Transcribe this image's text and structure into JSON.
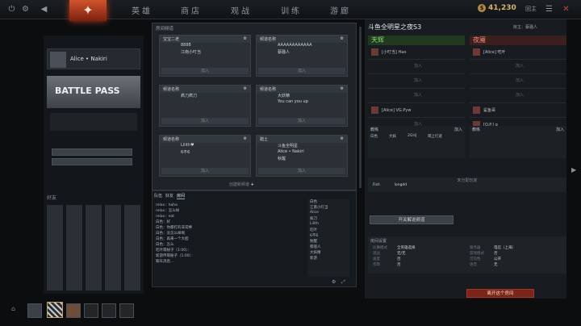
{
  "topbar": {
    "nav": [
      "英雄",
      "商店",
      "观战",
      "训练",
      "游廊"
    ],
    "gold": "41,230",
    "back": "回主"
  },
  "profile": {
    "name": "Alice • Nakiri",
    "bp": "BATTLE PASS",
    "btn1": "",
    "btn2": "",
    "friends_label": "好友"
  },
  "lobbies": {
    "title": "房间频道",
    "cards": [
      {
        "name": "宝宝二老",
        "rows": [
          [
            "",
            "8888"
          ],
          [
            "",
            "江南小叮当"
          ]
        ],
        "join": "加入"
      },
      {
        "name": "频道名称",
        "rows": [
          [
            "",
            "AAAAAAAAAAAA"
          ],
          [
            "",
            "蔡骚人"
          ]
        ],
        "join": "加入"
      },
      {
        "name": "频道名称",
        "rows": [
          [
            "",
            "疯刀疯刀"
          ]
        ],
        "join": "加入"
      },
      {
        "name": "频道名称",
        "rows": [
          [
            "",
            "大妖精"
          ],
          [
            "",
            "You can you up"
          ]
        ],
        "join": "加入"
      },
      {
        "name": "频道名称",
        "rows": [
          [
            "",
            "Lilith♥"
          ],
          [
            "",
            "6不6"
          ]
        ],
        "join": "加入"
      },
      {
        "name": "踏土",
        "rows": [
          [
            "",
            "斗鱼全明星"
          ],
          [
            "",
            "Alice • Nakiri"
          ],
          [
            "",
            "秋醒"
          ]
        ],
        "join": "加入"
      }
    ],
    "create": "创建新频道"
  },
  "chat": {
    "tabs": [
      "队伍",
      "好友",
      "房间"
    ],
    "lines": [
      "relax：haha",
      "relax：怎么样",
      "relax：eat",
      "白色：好",
      "白色：你都打的非常棒",
      "白色：没怎么样啊",
      "白色：再来一个大胆",
      "白色：怎么",
      "吃叶萌秘子（1:00）：",
      "新游传萌秘子（1:00）：",
      "聊天消息..."
    ],
    "members": [
      "白色",
      "江南小叮当",
      "Alice",
      "疯刀",
      "Lilith",
      "吃叶",
      "6不6",
      "秋醒",
      "蔡骚人",
      "大妖精",
      "新游"
    ]
  },
  "room": {
    "title": "斗鱼全明星之夜S3",
    "host": "房主：蔡骚人",
    "radiant": "天辉",
    "dire": "夜魇",
    "r_players": [
      "[小叮当] Hao",
      "",
      "",
      "",
      "[Alice] VG.Pyw",
      ""
    ],
    "d_players": [
      "[Alice] 吃叶",
      "",
      "",
      "",
      "鲨鱼哥",
      "[O.P.] q"
    ],
    "coach": "教练",
    "join": "加入",
    "r_coaches": [
      "白色",
      "大妖",
      "萌上叮迹",
      "2GHJ"
    ],
    "unassigned_title": "未分配玩家",
    "unassigned": [
      "Fish",
      "longdd"
    ],
    "open_btn": "开关解说频道",
    "settings_title": "房间设置",
    "settings": [
      [
        "比赛模式",
        "全英雄选择",
        "服务器",
        "电信（上海）"
      ],
      [
        "观战",
        "无/无",
        "游戏模式",
        "否"
      ],
      [
        "速度",
        "否",
        "可见性",
        "公开"
      ],
      [
        "作弊",
        "否",
        "语音",
        "无"
      ]
    ],
    "leave": "离开这个房间"
  }
}
